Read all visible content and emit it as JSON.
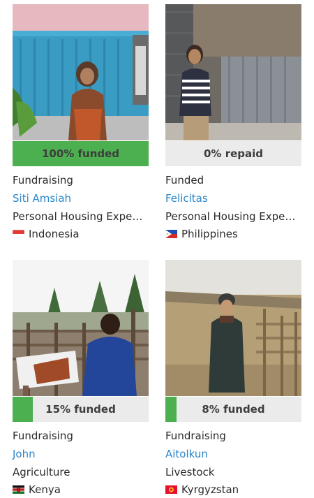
{
  "loans": [
    {
      "progress_label": "100% funded",
      "progress_fraction": 1.0,
      "status": "Fundraising",
      "borrower": "Siti Amsiah",
      "loan_use": "Personal Housing Expen...",
      "country": "Indonesia",
      "flag_icon": "indonesia-flag-icon"
    },
    {
      "progress_label": "0% repaid",
      "progress_fraction": 0.0,
      "status": "Funded",
      "borrower": "Felicitas",
      "loan_use": "Personal Housing Expen...",
      "country": "Philippines",
      "flag_icon": "philippines-flag-icon"
    },
    {
      "progress_label": "15% funded",
      "progress_fraction": 0.15,
      "status": "Fundraising",
      "borrower": "John",
      "loan_use": "Agriculture",
      "country": "Kenya",
      "flag_icon": "kenya-flag-icon"
    },
    {
      "progress_label": "8% funded",
      "progress_fraction": 0.08,
      "status": "Fundraising",
      "borrower": "Aitolkun",
      "loan_use": "Livestock",
      "country": "Kyrgyzstan",
      "flag_icon": "kyrgyzstan-flag-icon"
    }
  ],
  "colors": {
    "progress_fill": "#4caf50",
    "progress_track": "#ebebeb",
    "link": "#2a86c9",
    "text": "#2b2b2b"
  }
}
